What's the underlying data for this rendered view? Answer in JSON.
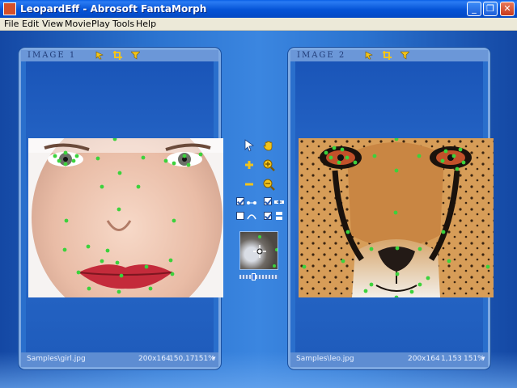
{
  "window": {
    "title": "LeopardEff - Abrosoft FantaMorph",
    "buttons": {
      "minimize": "_",
      "restore": "❐",
      "close": "✕"
    }
  },
  "menu": [
    "File",
    "Edit",
    "View",
    "Movie",
    "Play",
    "Tools",
    "Help"
  ],
  "panels": {
    "left": {
      "label": "IMAGE 1",
      "file": "Samples\\girl.jpg",
      "dimensions": "200x164",
      "coords": "150,17",
      "zoom": "151%",
      "icons": [
        "pointer-arrow-icon",
        "crop-icon",
        "filter-icon"
      ]
    },
    "right": {
      "label": "IMAGE 2",
      "file": "Samples\\leo.jpg",
      "dimensions": "200x164",
      "coords": "1,153",
      "zoom": "151%",
      "icons": [
        "pointer-arrow-icon",
        "crop-icon",
        "filter-icon"
      ]
    }
  },
  "tools": {
    "select": "select-pointer-icon",
    "hand": "hand-pan-icon",
    "add_point": "add-point-icon",
    "zoom_in": "zoom-in-icon",
    "remove_point": "remove-point-icon",
    "zoom_out": "zoom-out-icon",
    "checkboxes": [
      {
        "name": "show-points",
        "checked": true
      },
      {
        "name": "show-lines",
        "checked": true
      },
      {
        "name": "show-curves",
        "checked": false
      },
      {
        "name": "show-links",
        "checked": true
      }
    ],
    "zoom_slider_level": 0.35
  },
  "colors": {
    "keypoint": "#3cd23c",
    "accent": "#0553d6"
  }
}
